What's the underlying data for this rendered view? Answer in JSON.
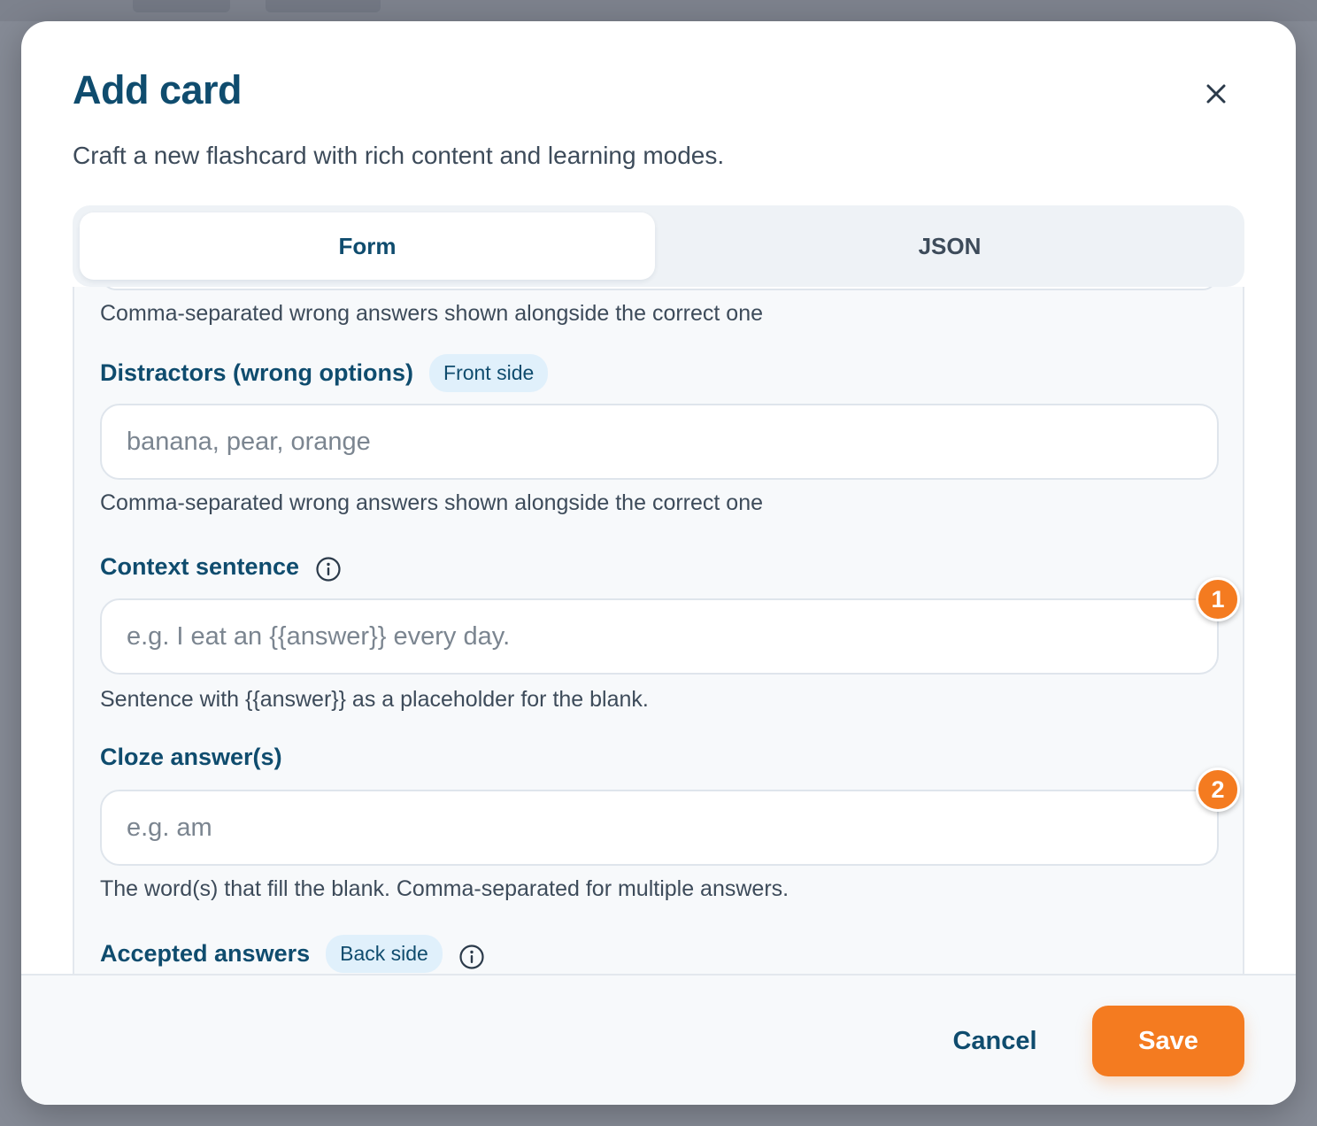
{
  "dialog": {
    "title": "Add card",
    "subtitle": "Craft a new flashcard with rich content and learning modes.",
    "close_icon": "close-icon"
  },
  "tabs": [
    {
      "label": "Form",
      "active": true
    },
    {
      "label": "JSON",
      "active": false
    }
  ],
  "form": {
    "prev_helper": "Comma-separated wrong answers shown alongside the correct one",
    "distractors": {
      "label": "Distractors (wrong options)",
      "badge": "Front side",
      "placeholder": "banana, pear, orange",
      "helper": "Comma-separated wrong answers shown alongside the correct one"
    },
    "context_sentence": {
      "label": "Context sentence",
      "icon": "info-icon",
      "placeholder": "e.g. I eat an {{answer}} every day.",
      "helper": "Sentence with {{answer}} as a placeholder for the blank.",
      "step": "1"
    },
    "cloze_answers": {
      "label": "Cloze answer(s)",
      "placeholder": "e.g. am",
      "helper": "The word(s) that fill the blank. Comma-separated for multiple answers.",
      "step": "2"
    },
    "accepted_answers": {
      "label": "Accepted answers",
      "badge": "Back side",
      "icon": "info-icon"
    }
  },
  "footer": {
    "cancel_label": "Cancel",
    "save_label": "Save"
  },
  "colors": {
    "accent": "#f47b20",
    "heading": "#0f4c6e",
    "badge_bg": "#e0f0fb"
  }
}
